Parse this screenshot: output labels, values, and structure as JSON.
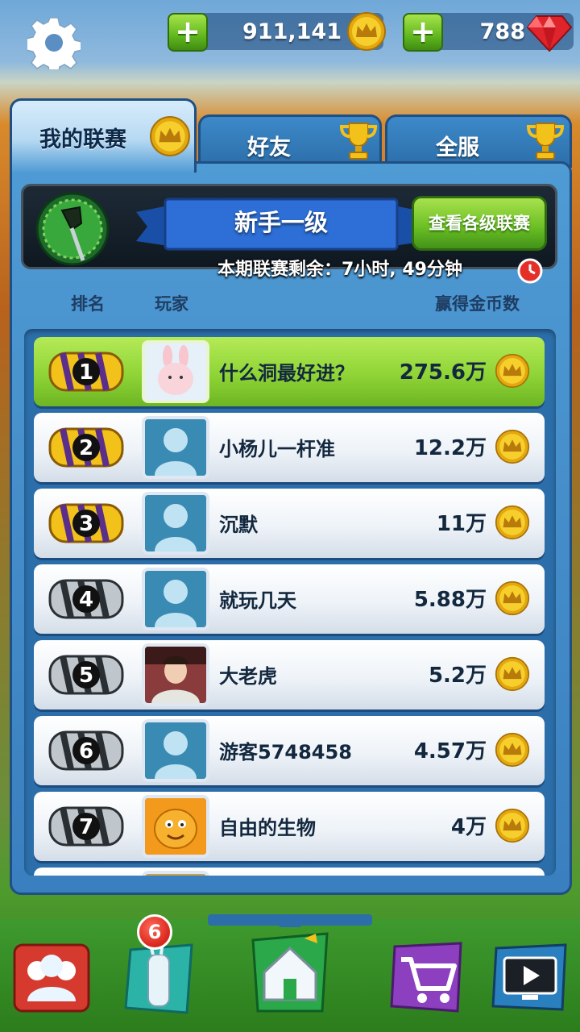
{
  "top_bar": {
    "coins": "911,141",
    "gems": "788",
    "plus_label": "+"
  },
  "tabs": [
    {
      "label": "我的联赛",
      "icon": "crown-coin-icon",
      "active": true
    },
    {
      "label": "好友",
      "icon": "trophy-icon",
      "active": false
    },
    {
      "label": "全服",
      "icon": "trophy-icon",
      "active": false
    }
  ],
  "league": {
    "name": "新手一级",
    "view_button": "查看各级联赛",
    "timer_text": "本期联赛剩余：7小时, 49分钟"
  },
  "columns": {
    "rank": "排名",
    "player": "玩家",
    "coins": "赢得金币数"
  },
  "leaderboard": [
    {
      "rank": "1",
      "name": "什么洞最好进？",
      "score": "275.6万",
      "medal": "gold",
      "avatar": "bunny-avatar",
      "me": true
    },
    {
      "rank": "2",
      "name": "小杨儿一杆准",
      "score": "12.2万",
      "medal": "gold",
      "avatar": "default-avatar",
      "me": false
    },
    {
      "rank": "3",
      "name": "沉默",
      "score": "11万",
      "medal": "gold",
      "avatar": "default-avatar",
      "me": false
    },
    {
      "rank": "4",
      "name": "就玩几天",
      "score": "5.88万",
      "medal": "silver",
      "avatar": "default-avatar",
      "me": false
    },
    {
      "rank": "5",
      "name": "大老虎",
      "score": "5.2万",
      "medal": "silver",
      "avatar": "photo-avatar",
      "me": false
    },
    {
      "rank": "6",
      "name": "游客5748458",
      "score": "4.57万",
      "medal": "silver",
      "avatar": "default-avatar",
      "me": false
    },
    {
      "rank": "7",
      "name": "自由的生物",
      "score": "4万",
      "medal": "silver",
      "avatar": "candy-avatar",
      "me": false
    }
  ],
  "bottom_nav": {
    "bag_badge": "6",
    "items": [
      "team-icon",
      "golf-bag-icon",
      "home-icon",
      "shop-cart-icon",
      "video-icon"
    ]
  },
  "colors": {
    "accent_green": "#8fd436",
    "panel_blue": "#3a7fbf",
    "gold": "#f2c21b"
  }
}
